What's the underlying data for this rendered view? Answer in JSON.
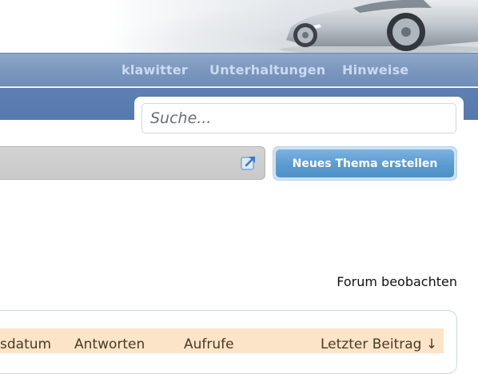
{
  "nav": {
    "items": [
      {
        "label": "klawitter"
      },
      {
        "label": "Unterhaltungen"
      },
      {
        "label": "Hinweise"
      }
    ]
  },
  "search": {
    "placeholder": "Suche..."
  },
  "toolbar": {
    "new_thread_label": "Neues Thema erstellen",
    "jump_icon": "external-link-icon"
  },
  "forum": {
    "watch_label": "Forum beobachten"
  },
  "table": {
    "columns": [
      "sdatum",
      "Antworten",
      "Aufrufe",
      "Letzter Beitrag ↓"
    ]
  },
  "colors": {
    "nav_bg": "#7e99bf",
    "nav_text": "#c9dbf2",
    "subbar_bg": "#5679ad",
    "button_bg": "#5c9bd1",
    "table_head_bg": "#fbe4c8"
  }
}
